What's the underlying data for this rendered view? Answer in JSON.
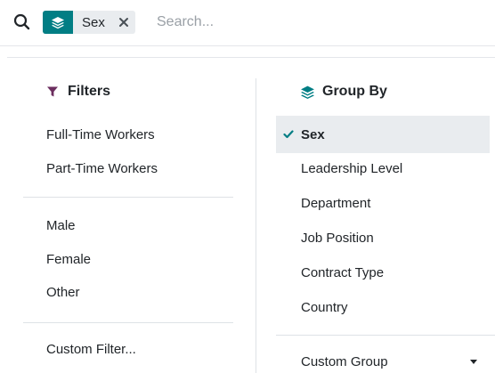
{
  "search": {
    "facet_label": "Sex",
    "placeholder": "Search...",
    "value": ""
  },
  "filters": {
    "title": "Filters",
    "group1": [
      "Full-Time Workers",
      "Part-Time Workers"
    ],
    "group2": [
      "Male",
      "Female",
      "Other"
    ],
    "custom": "Custom Filter..."
  },
  "group_by": {
    "title": "Group By",
    "selected": "Sex",
    "items": [
      "Leadership Level",
      "Department",
      "Job Position",
      "Contract Type",
      "Country"
    ],
    "custom": "Custom Group"
  },
  "colors": {
    "accent": "#017e84",
    "filter_icon": "#6c2e5f"
  }
}
